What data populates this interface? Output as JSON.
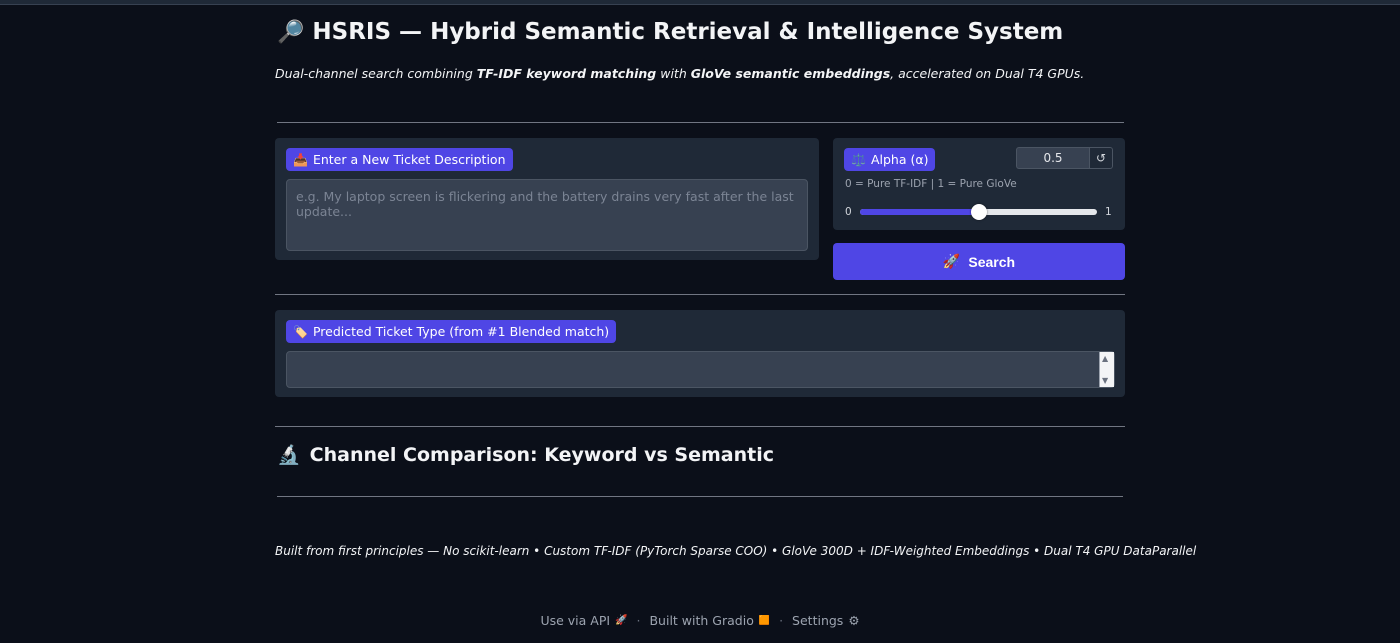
{
  "header": {
    "title_icon": "🔎",
    "title": "HSRIS — Hybrid Semantic Retrieval & Intelligence System",
    "subtitle": {
      "part1": "Dual-channel search combining ",
      "bold1": "TF-IDF keyword matching",
      "part2": " with ",
      "bold2": "GloVe semantic embeddings",
      "part3": ", accelerated on Dual T4 GPUs."
    }
  },
  "ticket_input": {
    "icon": "📥",
    "label": "Enter a New Ticket Description",
    "placeholder": "e.g. My laptop screen is flickering and the battery drains very fast after the last update...",
    "value": ""
  },
  "alpha": {
    "icon": "⚖️",
    "label": "Alpha (α)",
    "value": "0.5",
    "reset_icon": "↺",
    "hint": "0 = Pure TF-IDF | 1 = Pure GloVe",
    "min_label": "0",
    "max_label": "1",
    "level": 0.5
  },
  "search_button": {
    "icon": "🚀",
    "label": "Search"
  },
  "prediction": {
    "icon": "🏷️",
    "label": "Predicted Ticket Type (from #1 Blended match)",
    "value": "",
    "scroll_up": "▲",
    "scroll_down": "▼"
  },
  "comparison": {
    "icon": "🔬",
    "title": "Channel Comparison: Keyword vs Semantic"
  },
  "footnote": "Built from first principles — No scikit-learn • Custom TF-IDF (PyTorch Sparse COO) • GloVe 300D + IDF-Weighted Embeddings • Dual T4 GPU DataParallel",
  "footer": {
    "api_label": "Use via API",
    "api_icon": "🚀",
    "gradio_label": "Built with Gradio",
    "gradio_icon": "🟧",
    "settings_label": "Settings",
    "settings_icon": "⚙",
    "separator": "·"
  },
  "colors": {
    "background": "#0b0f19",
    "panel": "#1f2937",
    "accent": "#4f46e5"
  }
}
